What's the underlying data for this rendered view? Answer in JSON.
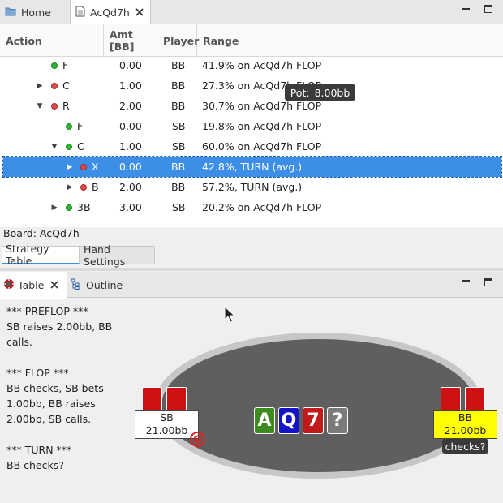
{
  "tabs": [
    {
      "label": "Home",
      "icon": "folder-icon"
    },
    {
      "label": "AcQd7h",
      "icon": "document-icon"
    }
  ],
  "columns": [
    "Action",
    "Amt [BB]",
    "Player",
    "Range"
  ],
  "rows": [
    {
      "action": "F",
      "amt": "0.00",
      "player": "BB",
      "range": "41.9% on AcQd7h FLOP"
    },
    {
      "action": "C",
      "amt": "1.00",
      "player": "BB",
      "range": "27.3% on AcQd7h FLOP"
    },
    {
      "action": "R",
      "amt": "2.00",
      "player": "BB",
      "range": "30.7% on AcQd7h FLOP"
    },
    {
      "action": "F",
      "amt": "0.00",
      "player": "SB",
      "range": "19.8% on AcQd7h FLOP"
    },
    {
      "action": "C",
      "amt": "1.00",
      "player": "SB",
      "range": "60.0% on AcQd7h FLOP"
    },
    {
      "action": "X",
      "amt": "0.00",
      "player": "BB",
      "range": "42.8%, TURN (avg.)"
    },
    {
      "action": "B",
      "amt": "2.00",
      "player": "BB",
      "range": "57.2%, TURN (avg.)"
    },
    {
      "action": "3B",
      "amt": "3.00",
      "player": "SB",
      "range": "20.2% on AcQd7h FLOP"
    }
  ],
  "board_label": "Board: AcQd7h",
  "subtabs": [
    "Strategy Table",
    "Hand Settings"
  ],
  "lower_tabs": [
    "Table",
    "Outline"
  ],
  "history": [
    "*** PREFLOP ***",
    "SB raises 2.00bb, BB",
    "calls.",
    "",
    "*** FLOP ***",
    "BB checks, SB bets",
    "1.00bb, BB raises",
    "2.00bb, SB calls.",
    "",
    "*** TURN ***",
    "BB checks?"
  ],
  "pot": {
    "label": "Pot:",
    "value": "8.00bb"
  },
  "board_cards": [
    "A",
    "Q",
    "7",
    "?"
  ],
  "seats": {
    "sb": {
      "name": "SB",
      "stack": "21.00bb"
    },
    "bb": {
      "name": "BB",
      "stack": "21.00bb",
      "action": "checks?"
    }
  },
  "colors": {
    "selection": "#3c8ee6",
    "club": "#3d8b1e",
    "diamond": "#1515c8",
    "heart": "#c01a1a",
    "unknown_card": "#7a7a7a",
    "bb_seat": "#ffff00",
    "dot_green": "#2fb52f",
    "dot_red": "#e04a4a"
  }
}
